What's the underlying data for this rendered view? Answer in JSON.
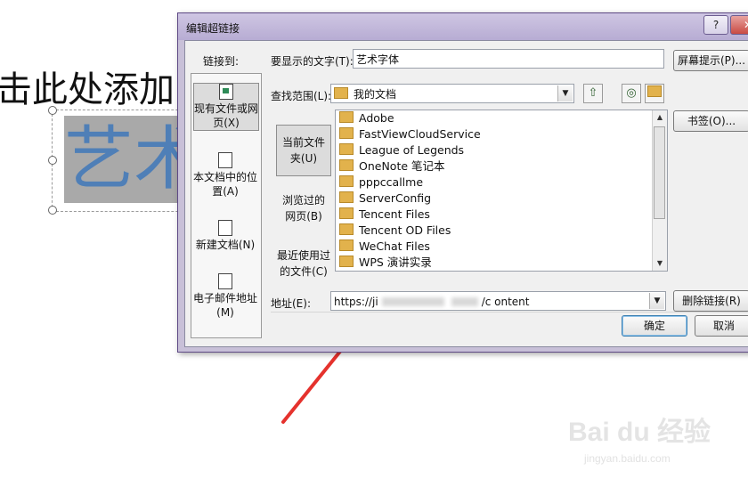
{
  "slide": {
    "title_fragment": "击此处添加",
    "art_text": "艺术",
    "top_fragment": ""
  },
  "dialog": {
    "title": "编辑超链接",
    "help_label": "?",
    "close_label": "✕",
    "link_to_label": "链接到:",
    "link_to_items": [
      {
        "label_1": "现有文件或网",
        "label_2": "页(X)",
        "icon": "web-page-icon",
        "selected": true
      },
      {
        "label_1": "本文档中的位",
        "label_2": "置(A)",
        "icon": "document-place-icon",
        "selected": false
      },
      {
        "label_1": "新建文档(N)",
        "label_2": "",
        "icon": "new-document-icon",
        "selected": false
      },
      {
        "label_1": "电子邮件地址",
        "label_2": "(M)",
        "icon": "email-icon",
        "selected": false
      }
    ],
    "display_text_label": "要显示的文字(T):",
    "display_text_value": "艺术字体",
    "screentip_button": "屏幕提示(P)...",
    "look_in_label": "查找范围(L):",
    "look_in_value": "我的文档",
    "nav_items": [
      {
        "label_1": "当前文件",
        "label_2": "夹(U)",
        "selected": true
      },
      {
        "label_1": "浏览过的",
        "label_2": "网页(B)",
        "selected": false
      },
      {
        "label_1": "最近使用过",
        "label_2": "的文件(C)",
        "selected": false
      }
    ],
    "files": [
      "Adobe",
      "FastViewCloudService",
      "League of Legends",
      "OneNote 笔记本",
      "pppccallme",
      "ServerConfig",
      "Tencent Files",
      "Tencent OD Files",
      "WeChat Files",
      "WPS 演讲实录"
    ],
    "bookmark_button": "书签(O)...",
    "address_label": "地址(E):",
    "address_value_start": "https://ji",
    "address_value_end": "/c    ontent",
    "remove_link_button": "删除链接(R)",
    "ok_button": "确定",
    "cancel_button": "取消"
  },
  "watermark": {
    "brand": "Bai du 经验",
    "url": "jingyan.baidu.com"
  },
  "colors": {
    "dialog_frame": "#c8c0d8",
    "arrow": "#e5322d",
    "art_text": "#4f7fb7"
  }
}
